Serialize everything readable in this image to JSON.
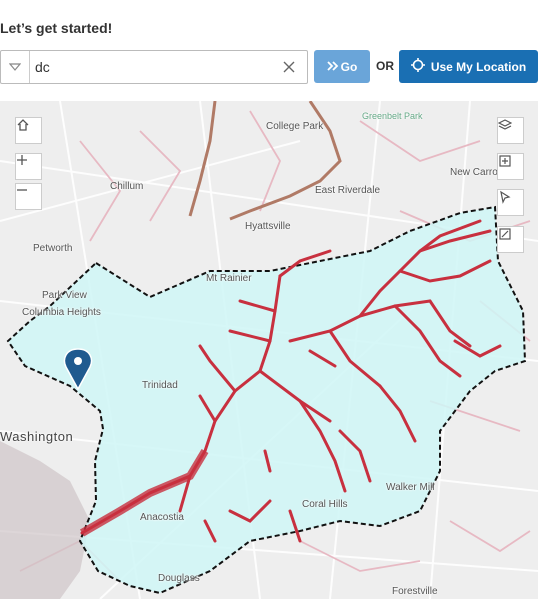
{
  "header": {
    "title": "Let’s get started!"
  },
  "search": {
    "value": "dc",
    "placeholder": "",
    "clear_icon": "close-icon"
  },
  "buttons": {
    "go_label": "Go",
    "or_label": "OR",
    "location_label": "Use My Location"
  },
  "map": {
    "labels": {
      "college_park": "College Park",
      "greenbelt_park": "Greenbelt Park",
      "new_carrollton": "New Carrollton",
      "chillum": "Chillum",
      "east_riverdale": "East Riverdale",
      "hyattsville": "Hyattsville",
      "petworth": "Petworth",
      "mt_rainier": "Mt Rainier",
      "park_view": "Park View",
      "columbia_heights": "Columbia Heights",
      "trinidad": "Trinidad",
      "washington": "Washington",
      "anacostia": "Anacostia",
      "coral_hills": "Coral Hills",
      "walker_mill": "Walker Mill",
      "douglass": "Douglass",
      "forestville": "Forestville"
    },
    "accent_watershed": "#c8303f",
    "fill_watershed": "#cff6f6"
  }
}
